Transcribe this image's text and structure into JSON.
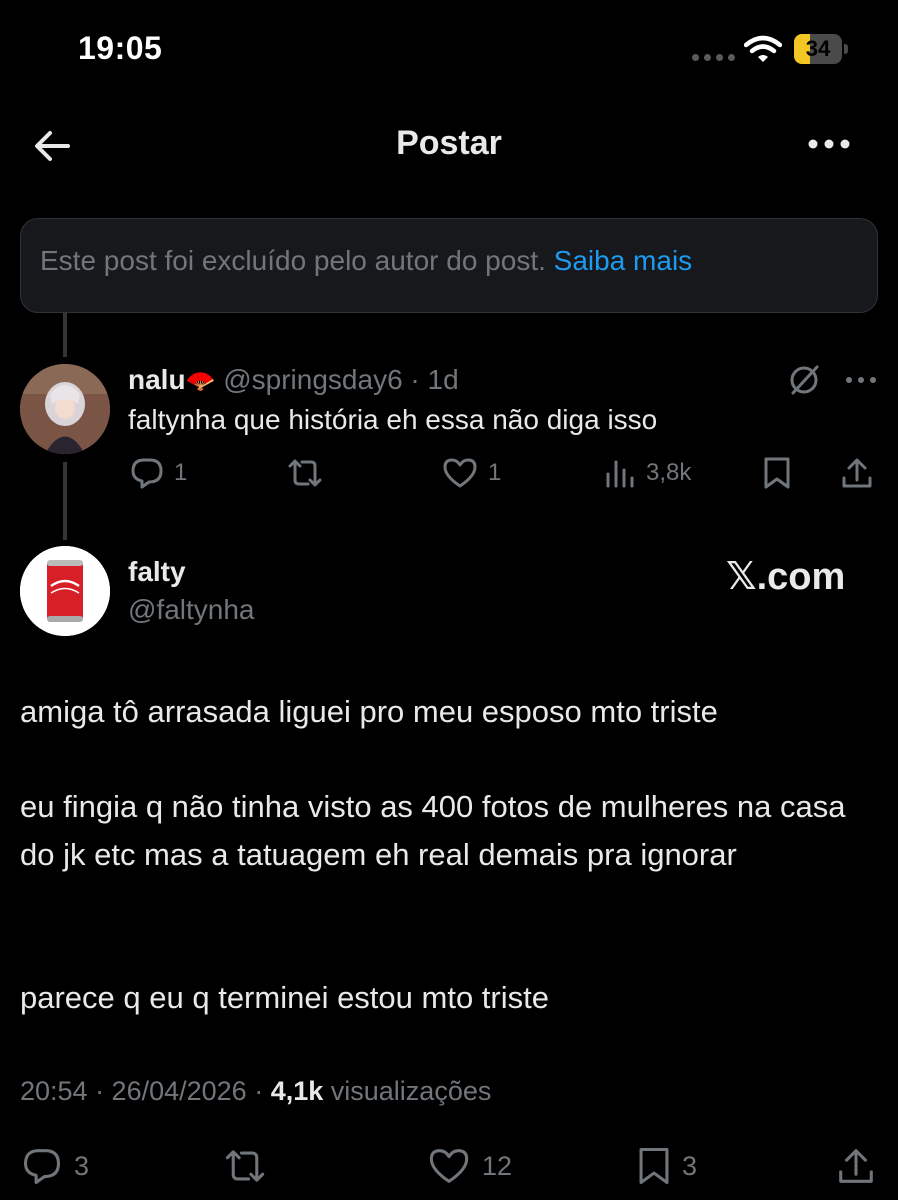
{
  "status_bar": {
    "time": "19:05",
    "battery": "34",
    "battery_level": 0.34
  },
  "nav": {
    "title": "Postar"
  },
  "deleted_notice": {
    "text": "Este post foi excluído pelo autor do post.",
    "link": "Saiba mais"
  },
  "reply": {
    "name": "nalu",
    "name_emoji": "🪭",
    "handle": "@springsday6",
    "separator": "·",
    "time": "1d",
    "text": "faltynha que história eh essa não diga isso",
    "replies": "1",
    "likes": "1",
    "views": "3,8k"
  },
  "post": {
    "name": "falty",
    "handle": "@faltynha",
    "watermark": "𝕏.com",
    "paragraphs": [
      "amiga tô arrasada liguei pro meu esposo mto triste",
      "eu fingia q não tinha visto as 400 fotos de mulheres na casa do jk etc mas a tatuagem eh real demais pra ignorar",
      "parece q eu q terminei estou mto triste"
    ],
    "timestamp": "20:54 · 26/04/2026 ·",
    "views_count": "4,1k",
    "views_label": "visualizações",
    "replies": "3",
    "likes": "12",
    "bookmarks": "3"
  },
  "colors": {
    "background": "#000000",
    "text": "#e7e9ea",
    "secondary": "#71767b",
    "link": "#1d9bf0",
    "battery": "#f3c623"
  }
}
